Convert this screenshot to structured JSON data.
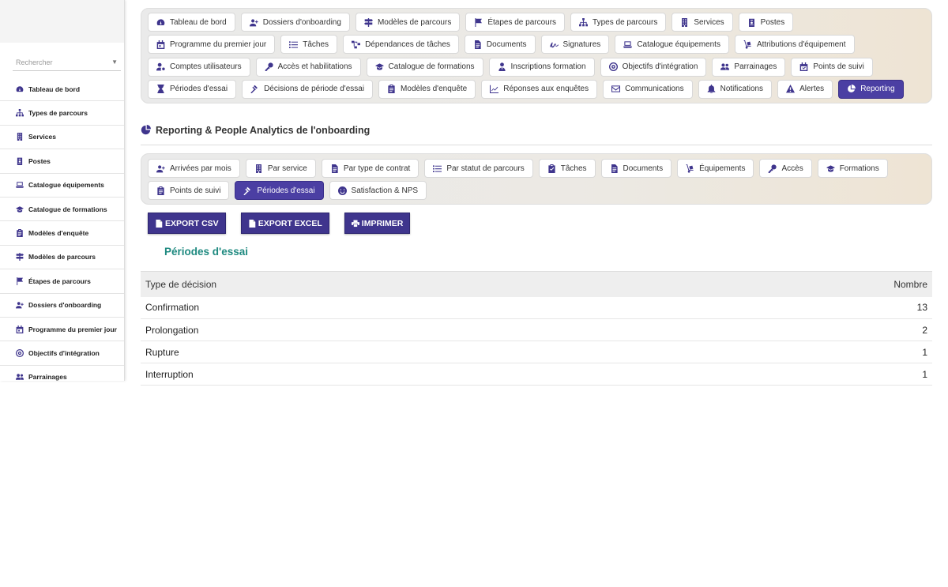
{
  "sidebar": {
    "search_placeholder": "Rechercher",
    "items": [
      {
        "label": "Tableau de bord",
        "icon": "dashboard-icon"
      },
      {
        "label": "Types de parcours",
        "icon": "sitemap-icon"
      },
      {
        "label": "Services",
        "icon": "building-icon"
      },
      {
        "label": "Postes",
        "icon": "badge-icon"
      },
      {
        "label": "Catalogue équipements",
        "icon": "laptop-icon"
      },
      {
        "label": "Catalogue de formations",
        "icon": "graduation-cap-icon"
      },
      {
        "label": "Modèles d'enquête",
        "icon": "clipboard-icon"
      },
      {
        "label": "Modèles de parcours",
        "icon": "signpost-icon"
      },
      {
        "label": "Étapes de parcours",
        "icon": "flag-icon"
      },
      {
        "label": "Dossiers d'onboarding",
        "icon": "user-plus-icon"
      },
      {
        "label": "Programme du premier jour",
        "icon": "calendar-icon"
      },
      {
        "label": "Objectifs d'intégration",
        "icon": "target-icon"
      },
      {
        "label": "Parrainages",
        "icon": "users-icon"
      }
    ]
  },
  "topnav": [
    {
      "label": "Tableau de bord",
      "icon": "dashboard-icon",
      "active": false
    },
    {
      "label": "Dossiers d'onboarding",
      "icon": "user-plus-icon",
      "active": false
    },
    {
      "label": "Modèles de parcours",
      "icon": "signpost-icon",
      "active": false
    },
    {
      "label": "Étapes de parcours",
      "icon": "flag-icon",
      "active": false
    },
    {
      "label": "Types de parcours",
      "icon": "sitemap-icon",
      "active": false
    },
    {
      "label": "Services",
      "icon": "building-icon",
      "active": false
    },
    {
      "label": "Postes",
      "icon": "badge-icon",
      "active": false
    },
    {
      "label": "Programme du premier jour",
      "icon": "calendar-icon",
      "active": false
    },
    {
      "label": "Tâches",
      "icon": "list-icon",
      "active": false
    },
    {
      "label": "Dépendances de tâches",
      "icon": "project-diagram-icon",
      "active": false
    },
    {
      "label": "Documents",
      "icon": "file-icon",
      "active": false
    },
    {
      "label": "Signatures",
      "icon": "signature-icon",
      "active": false
    },
    {
      "label": "Catalogue équipements",
      "icon": "laptop-icon",
      "active": false
    },
    {
      "label": "Attributions d'équipement",
      "icon": "dolly-icon",
      "active": false
    },
    {
      "label": "Comptes utilisateurs",
      "icon": "user-cog-icon",
      "active": false
    },
    {
      "label": "Accès et habilitations",
      "icon": "key-icon",
      "active": false
    },
    {
      "label": "Catalogue de formations",
      "icon": "graduation-cap-icon",
      "active": false
    },
    {
      "label": "Inscriptions formation",
      "icon": "user-tie-icon",
      "active": false
    },
    {
      "label": "Objectifs d'intégration",
      "icon": "target-icon",
      "active": false
    },
    {
      "label": "Parrainages",
      "icon": "users-icon",
      "active": false
    },
    {
      "label": "Points de suivi",
      "icon": "calendar-check-icon",
      "active": false
    },
    {
      "label": "Périodes d'essai",
      "icon": "hourglass-icon",
      "active": false
    },
    {
      "label": "Décisions de période d'essai",
      "icon": "gavel-icon",
      "active": false
    },
    {
      "label": "Modèles d'enquête",
      "icon": "clipboard-icon",
      "active": false
    },
    {
      "label": "Réponses aux enquêtes",
      "icon": "chart-line-icon",
      "active": false
    },
    {
      "label": "Communications",
      "icon": "envelope-icon",
      "active": false
    },
    {
      "label": "Notifications",
      "icon": "bell-icon",
      "active": false
    },
    {
      "label": "Alertes",
      "icon": "warning-icon",
      "active": false
    },
    {
      "label": "Reporting",
      "icon": "chart-pie-icon",
      "active": true
    }
  ],
  "page_title": "Reporting & People Analytics de l'onboarding",
  "subnav": [
    {
      "label": "Arrivées par mois",
      "icon": "user-plus-icon",
      "active": false
    },
    {
      "label": "Par service",
      "icon": "building-icon",
      "active": false
    },
    {
      "label": "Par type de contrat",
      "icon": "file-icon",
      "active": false
    },
    {
      "label": "Par statut de parcours",
      "icon": "list-icon",
      "active": false
    },
    {
      "label": "Tâches",
      "icon": "clipboard-check-icon",
      "active": false
    },
    {
      "label": "Documents",
      "icon": "file-icon",
      "active": false
    },
    {
      "label": "Équipements",
      "icon": "dolly-icon",
      "active": false
    },
    {
      "label": "Accès",
      "icon": "key-icon",
      "active": false
    },
    {
      "label": "Formations",
      "icon": "graduation-cap-icon",
      "active": false
    },
    {
      "label": "Points de suivi",
      "icon": "clipboard-icon",
      "active": false
    },
    {
      "label": "Périodes d'essai",
      "icon": "gavel-icon",
      "active": true
    },
    {
      "label": "Satisfaction & NPS",
      "icon": "smile-icon",
      "active": false
    }
  ],
  "actions": {
    "export_csv": "EXPORT CSV",
    "export_excel": "EXPORT EXCEL",
    "print": "IMPRIMER"
  },
  "report": {
    "title": "Périodes d'essai",
    "columns": [
      "Type de décision",
      "Nombre"
    ],
    "rows": [
      {
        "decision": "Confirmation",
        "count": "13"
      },
      {
        "decision": "Prolongation",
        "count": "2"
      },
      {
        "decision": "Rupture",
        "count": "1"
      },
      {
        "decision": "Interruption",
        "count": "1"
      }
    ]
  },
  "colors": {
    "accent": "#4b3fa3",
    "button": "#3f358d",
    "report_title": "#1f8a80"
  }
}
